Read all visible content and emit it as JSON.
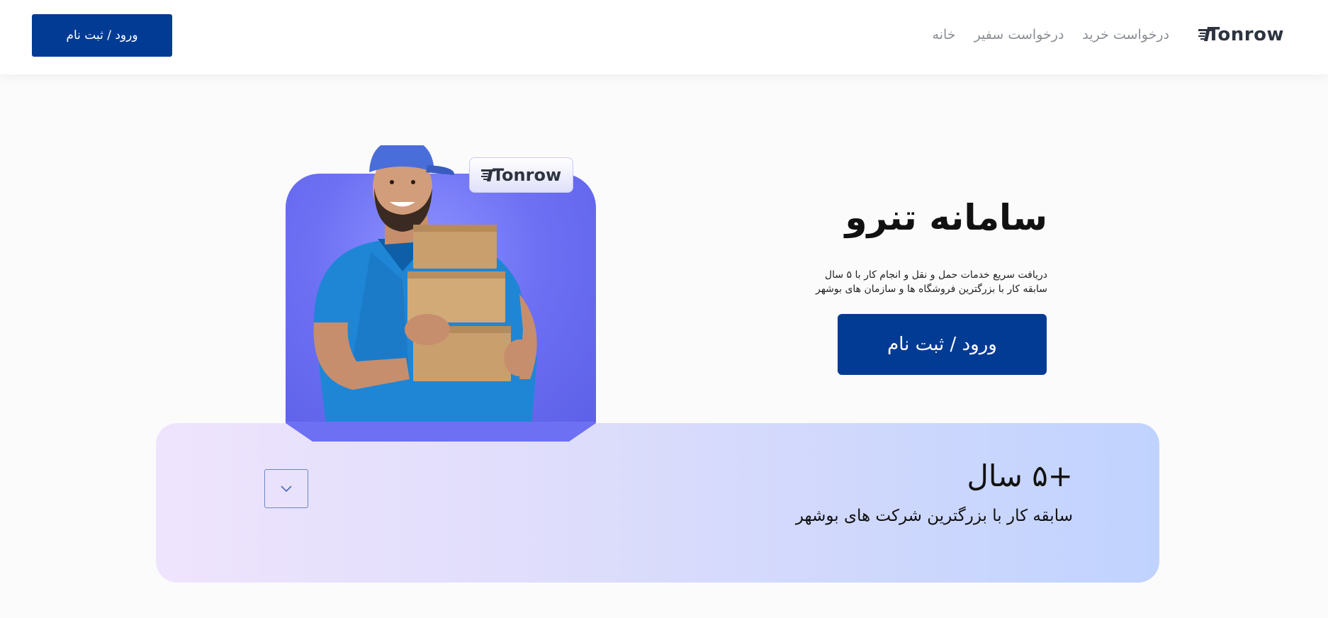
{
  "header": {
    "brand": "Tonrow",
    "nav": [
      "خانه",
      "درخواست سفیر",
      "درخواست خرید"
    ],
    "login_label": "ورود / ثبت نام"
  },
  "hero": {
    "badge_brand": "Tonrow",
    "title": "سامانه تنرو",
    "subtitle_line1": "دریافت سریع خدمات حمل و نقل و انجام کار با ۵ سال",
    "subtitle_line2": "سابقه کار با بزرگترین فروشگاه ها و سازمان های بوشهر",
    "login_label": "ورود / ثبت نام"
  },
  "stats": {
    "value": "+۵ سال",
    "label": "سابقه کار با بزرگترین شرکت های بوشهر",
    "scroll_icon": "chevron-down-icon"
  },
  "colors": {
    "primary": "#023b94",
    "nav_text": "#8a8f96",
    "photo_bg": "#6d70f3",
    "card_gradient_start": "#efe4fd",
    "card_gradient_end": "#c0d3fe"
  }
}
